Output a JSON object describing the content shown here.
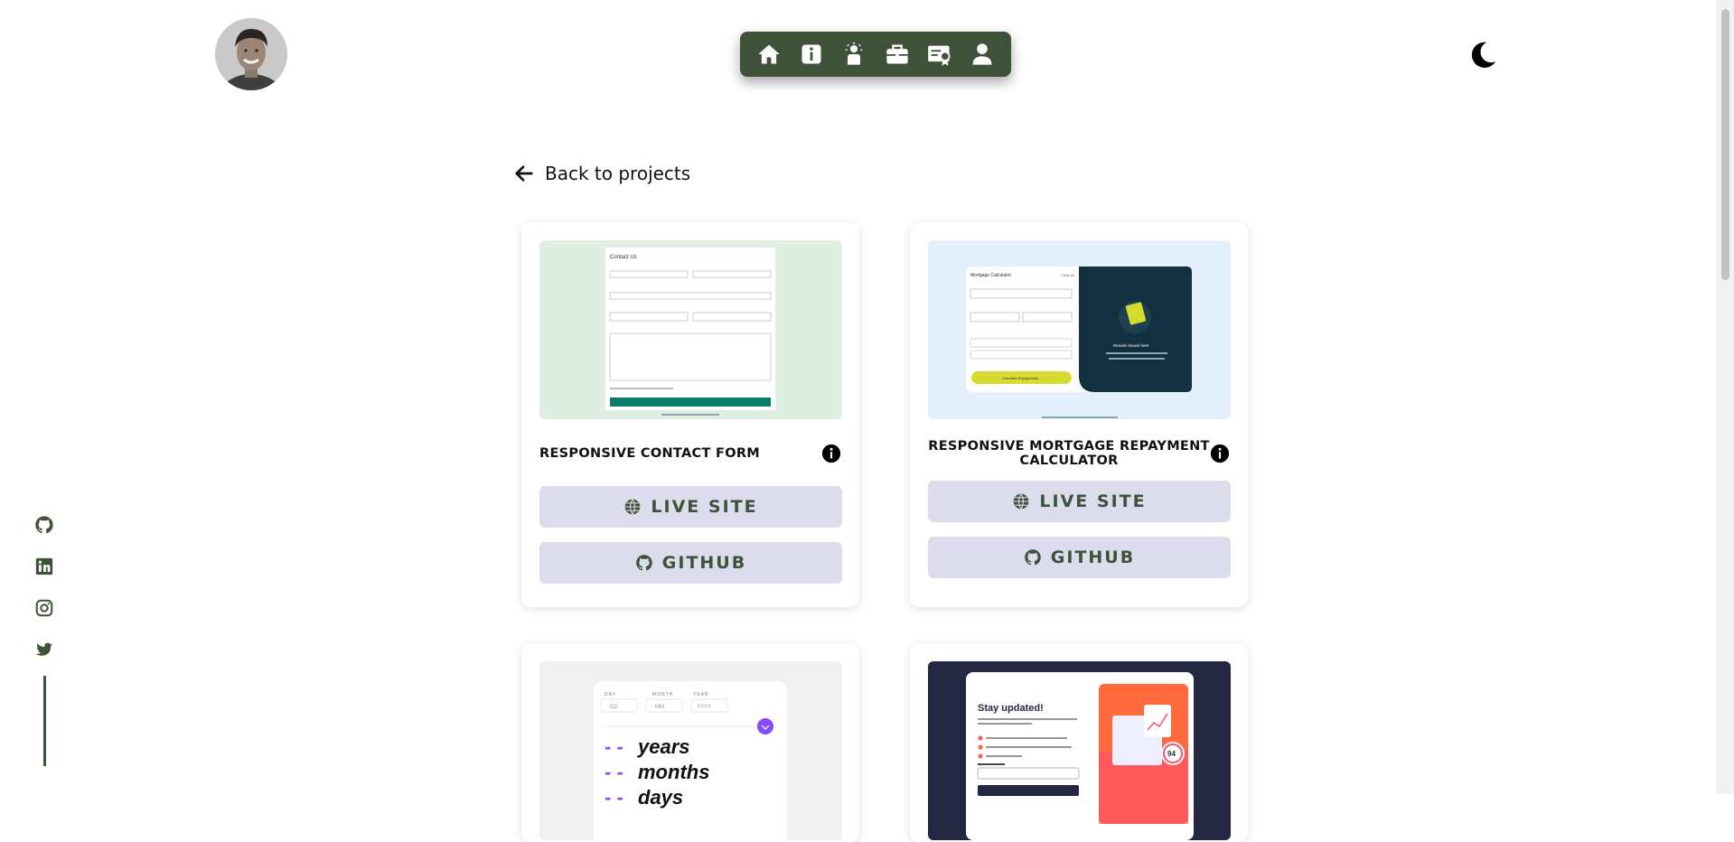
{
  "header": {
    "nav": [
      {
        "icon": "home-icon"
      },
      {
        "icon": "info-icon"
      },
      {
        "icon": "skills-icon"
      },
      {
        "icon": "briefcase-icon"
      },
      {
        "icon": "certificate-icon"
      },
      {
        "icon": "user-icon"
      }
    ],
    "theme_toggle_icon": "moon-icon"
  },
  "back_link": {
    "label": "Back to projects"
  },
  "projects": [
    {
      "title": "RESPONSIVE CONTACT FORM",
      "live_label": "LIVE SITE",
      "github_label": "GITHUB"
    },
    {
      "title": "RESPONSIVE MORTGAGE REPAYMENT CALCULATOR",
      "live_label": "LIVE SITE",
      "github_label": "GITHUB"
    },
    {
      "title": "",
      "live_label": "",
      "github_label": ""
    },
    {
      "title": "",
      "live_label": "",
      "github_label": ""
    }
  ],
  "thumbs": {
    "contact": {
      "heading": "Contact Us"
    },
    "mortgage": {
      "heading": "Mortgage Calculator",
      "clear": "Clear All",
      "results_title": "Results shown here",
      "button": "Calculate Repayments"
    },
    "age": {
      "day": "DAY",
      "month": "MONTH",
      "year": "YEAR",
      "day_ph": "DD",
      "month_ph": "MM",
      "year_ph": "YYYY",
      "years": "years",
      "months": "months",
      "days": "days",
      "dashes": "- -"
    },
    "newsletter": {
      "heading": "Stay updated!",
      "badge": "94"
    }
  },
  "socials": [
    {
      "icon": "github-icon"
    },
    {
      "icon": "linkedin-icon"
    },
    {
      "icon": "instagram-icon"
    },
    {
      "icon": "twitter-icon"
    }
  ],
  "colors": {
    "primary": "#3e5139",
    "button_bg": "#dcdced",
    "background": "#ffffff"
  }
}
